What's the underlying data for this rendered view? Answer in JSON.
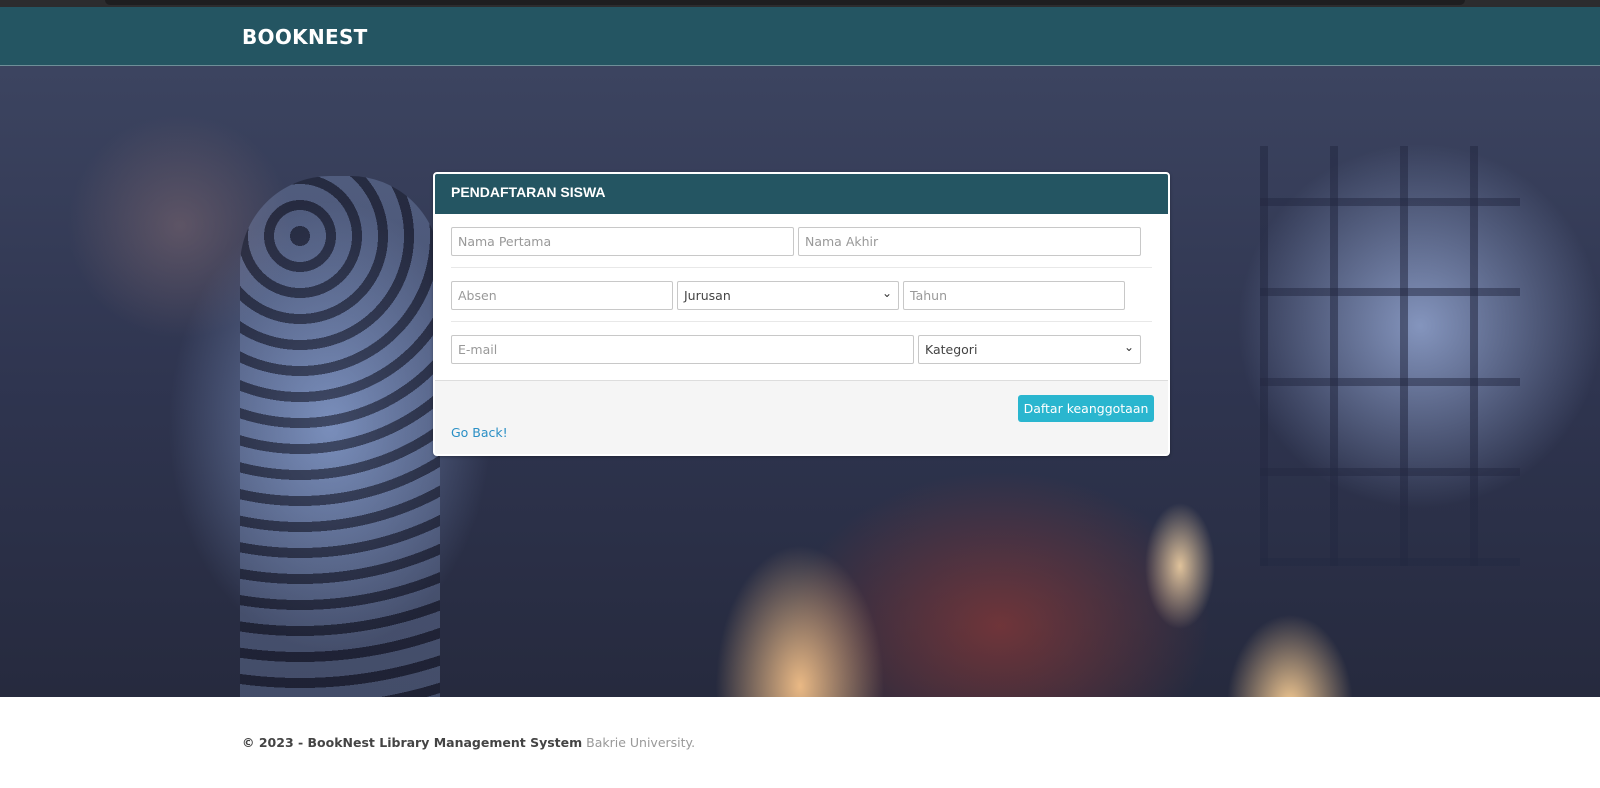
{
  "navbar": {
    "brand": "BOOKNEST"
  },
  "form": {
    "title": "PENDAFTARAN SISWA",
    "first_name_placeholder": "Nama Pertama",
    "last_name_placeholder": "Nama Akhir",
    "absen_placeholder": "Absen",
    "jurusan_selected": "Jurusan",
    "tahun_placeholder": "Tahun",
    "email_placeholder": "E-mail",
    "kategori_selected": "Kategori",
    "submit_label": "Daftar keanggotaan",
    "back_label": "Go Back!"
  },
  "footer": {
    "copyright": "© 2023 - BookNest Library Management System",
    "organization": "Bakrie University."
  },
  "colors": {
    "primary": "#245562",
    "accent": "#2ab6cf",
    "link": "#2a8fc5"
  }
}
